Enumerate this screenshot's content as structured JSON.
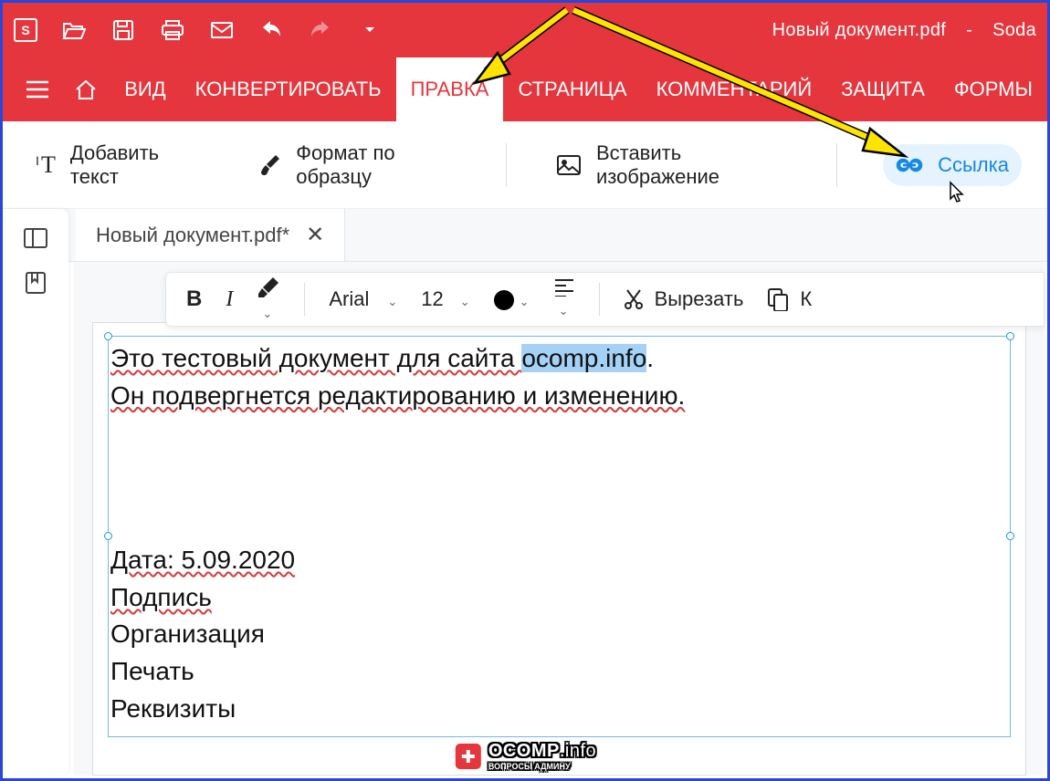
{
  "app": {
    "document_title": "Новый документ.pdf",
    "brand": "Soda",
    "title_sep": "-"
  },
  "menu": {
    "vid": "ВИД",
    "convert": "КОНВЕРТИРОВАТЬ",
    "edit": "ПРАВКА",
    "page": "СТРАНИЦА",
    "comment": "КОММЕНТАРИЙ",
    "protect": "ЗАЩИТА",
    "forms": "ФОРМЫ"
  },
  "ribbon": {
    "add_text": "Добавить текст",
    "format_painter": "Формат по образцу",
    "insert_image": "Вставить изображение",
    "link": "Ссылка"
  },
  "tab": {
    "name": "Новый документ.pdf*"
  },
  "format": {
    "font": "Arial",
    "size": "12",
    "cut": "Вырезать",
    "copy_initial": "К"
  },
  "doc": {
    "line1a": "Это тестовый документ для сайта ",
    "line1b": "ocomp.info",
    "line1c": ".",
    "line2": "Он подвергнется редактированию и изменению.",
    "date_line": "Дата: 5.09.2020",
    "signature": "Подпись",
    "organization": "Организация",
    "stamp": "Печать",
    "requisites": "Реквизиты"
  },
  "watermark": {
    "name": "OCOMP",
    "tld": ".info",
    "sub": "ВОПРОСЫ АДМИНУ"
  }
}
